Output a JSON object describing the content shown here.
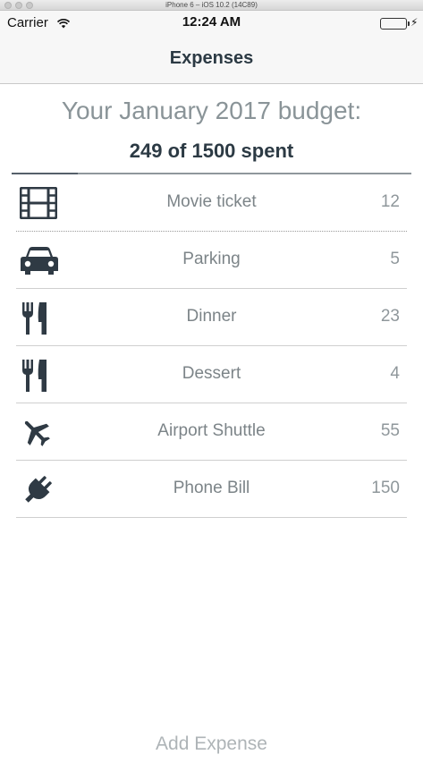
{
  "simulator": {
    "title": "iPhone 6 – iOS 10.2 (14C89)"
  },
  "status_bar": {
    "carrier": "Carrier",
    "time": "12:24 AM"
  },
  "nav": {
    "title": "Expenses"
  },
  "budget": {
    "title": "Your January 2017 budget:",
    "spent_text": "249 of 1500 spent",
    "spent": 249,
    "total": 1500
  },
  "expenses": [
    {
      "name": "Movie ticket",
      "amount": "12",
      "icon": "film-icon"
    },
    {
      "name": "Parking",
      "amount": "5",
      "icon": "car-icon"
    },
    {
      "name": "Dinner",
      "amount": "23",
      "icon": "cutlery-icon"
    },
    {
      "name": "Dessert",
      "amount": "4",
      "icon": "cutlery-icon"
    },
    {
      "name": "Airport Shuttle",
      "amount": "55",
      "icon": "airplane-icon"
    },
    {
      "name": "Phone Bill",
      "amount": "150",
      "icon": "plug-icon"
    }
  ],
  "actions": {
    "add_label": "Add Expense"
  },
  "colors": {
    "icon": "#2f3a44",
    "text_muted": "#7c8488",
    "accent_dark": "#2c3a44"
  }
}
